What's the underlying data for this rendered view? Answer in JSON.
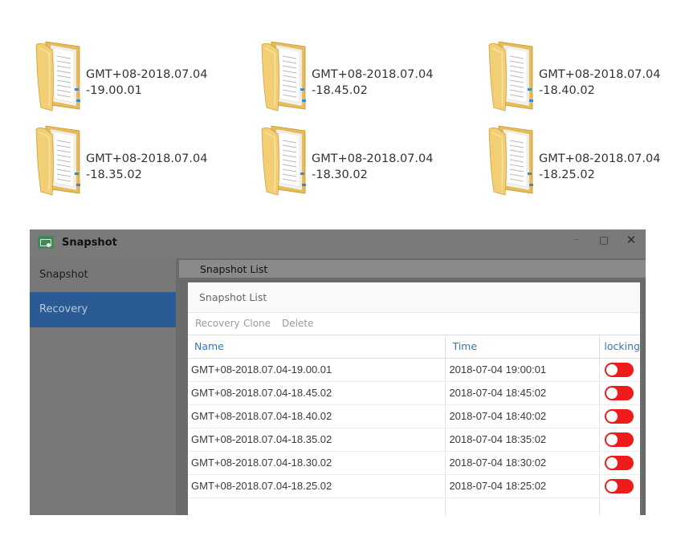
{
  "folders": [
    {
      "line1": "GMT+08-2018.07.04",
      "line2": "-19.00.01"
    },
    {
      "line1": "GMT+08-2018.07.04",
      "line2": "-18.45.02"
    },
    {
      "line1": "GMT+08-2018.07.04",
      "line2": "-18.40.02"
    },
    {
      "line1": "GMT+08-2018.07.04",
      "line2": "-18.35.02"
    },
    {
      "line1": "GMT+08-2018.07.04",
      "line2": "-18.30.02"
    },
    {
      "line1": "GMT+08-2018.07.04",
      "line2": "-18.25.02"
    }
  ],
  "window": {
    "title": "Snapshot",
    "icon": "snapshot-app-icon",
    "controls": {
      "minimize": "–",
      "maximize": "□",
      "close": "✕"
    }
  },
  "sidebar": {
    "items": [
      {
        "label": "Snapshot"
      },
      {
        "label": "Recovery",
        "active": true
      }
    ]
  },
  "tab": {
    "label": "Snapshot List"
  },
  "panel": {
    "title": "Snapshot List",
    "toolbar": {
      "recovery": "Recovery",
      "clone": "Clone",
      "delete": "Delete"
    },
    "columns": {
      "name": "Name",
      "time": "Time",
      "locking": "locking"
    },
    "rows": [
      {
        "name": "GMT+08-2018.07.04-19.00.01",
        "time": "2018-07-04 19:00:01",
        "locked": false
      },
      {
        "name": "GMT+08-2018.07.04-18.45.02",
        "time": "2018-07-04 18:45:02",
        "locked": false
      },
      {
        "name": "GMT+08-2018.07.04-18.40.02",
        "time": "2018-07-04 18:40:02",
        "locked": false
      },
      {
        "name": "GMT+08-2018.07.04-18.35.02",
        "time": "2018-07-04 18:35:02",
        "locked": false
      },
      {
        "name": "GMT+08-2018.07.04-18.30.02",
        "time": "2018-07-04 18:30:02",
        "locked": false
      },
      {
        "name": "GMT+08-2018.07.04-18.25.02",
        "time": "2018-07-04 18:25:02",
        "locked": false
      }
    ]
  },
  "colors": {
    "toggle_off": "#ee1b1b",
    "active_sidebar": "#2a5b95",
    "header_link": "#2f78c8"
  }
}
